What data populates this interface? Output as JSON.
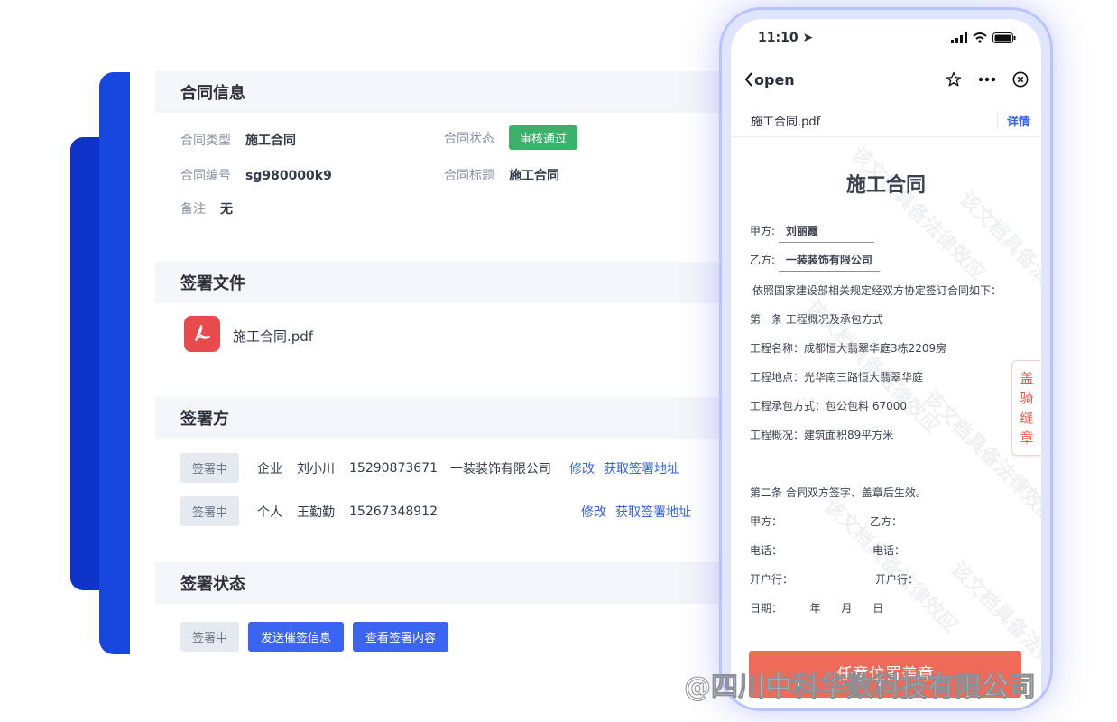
{
  "contract_info": {
    "title": "合同信息",
    "type_label": "合同类型",
    "type_value": "施工合同",
    "status_label": "合同状态",
    "status_value": "审核通过",
    "number_label": "合同编号",
    "number_value": "sg980000k9",
    "title_label": "合同标题",
    "title_value": "施工合同",
    "remark_label": "备注",
    "remark_value": "无"
  },
  "sign_files": {
    "title": "签署文件",
    "file_name": "施工合同.pdf"
  },
  "signers": {
    "title": "签署方",
    "rows": [
      {
        "status": "签署中",
        "kind": "企业",
        "name": "刘小川",
        "phone": "15290873671",
        "company": "一装装饰有限公司",
        "edit": "修改",
        "get_addr": "获取签署地址"
      },
      {
        "status": "签署中",
        "kind": "个人",
        "name": "王勤勤",
        "phone": "15267348912",
        "company": "",
        "edit": "修改",
        "get_addr": "获取签署地址"
      }
    ]
  },
  "sign_status": {
    "title": "签署状态",
    "status": "签署中",
    "send_btn": "发送催签信息",
    "view_btn": "查看签署内容"
  },
  "phone": {
    "time": "11:10",
    "back_label": "open",
    "doc_name": "施工合同.pdf",
    "detail_link": "详情",
    "doc_title": "施工合同",
    "party_a_label": "甲方:",
    "party_a_value": "刘丽霞",
    "party_b_label": "乙方:",
    "party_b_value": "一装装饰有限公司",
    "intro": "依照国家建设部相关规定经双方协定签订合同如下：",
    "art1": "第一条  工程概况及承包方式",
    "proj_name": "工程名称：成都恒大翡翠华庭3栋2209房",
    "proj_addr": "工程地点：光华南三路恒大翡翠华庭",
    "proj_mode": "工程承包方式：包公包料    67000",
    "proj_area": "工程概况：建筑面积89平方米",
    "art2": "第二条  合同双方签字、盖章后生效。",
    "sig_a": "甲方：",
    "sig_b": "乙方：",
    "tel_a": "电话：",
    "tel_b": "电话：",
    "bank_a": "开户行：",
    "bank_b": "开户行：",
    "date": "日期：        年      月      日",
    "seal_tab": "盖\n骑\n缝\n章",
    "seal_btn": "任意位置盖章",
    "watermark": "该文档具备法律效应"
  },
  "footer_watermark": "@四川中科华数科技有限公司",
  "colors": {
    "accent": "#3b64f2",
    "approved": "#3bb26b",
    "seal": "#f06a5a",
    "deco": "#1847e0"
  }
}
